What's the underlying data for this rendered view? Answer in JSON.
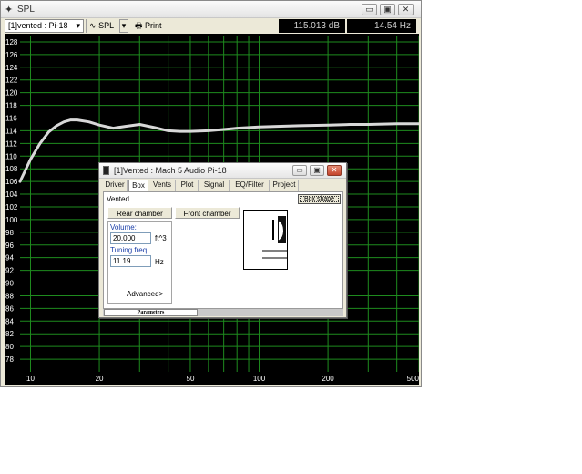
{
  "window": {
    "title": "SPL",
    "title_icon": "✦",
    "min_btn": "▭",
    "max_btn": "▣",
    "close_btn": "✕"
  },
  "toolbar": {
    "project_combo": "[1]vented : Pi-18",
    "combo_arrow": "▾",
    "spl_label": "SPL",
    "spl_icon": "∿",
    "spl_arrow": "▾",
    "print_label": "Print",
    "print_icon": "🖶",
    "db_readout": "115.013 dB",
    "hz_readout": "14.54 Hz"
  },
  "plot": {
    "y_ticks": [
      "128",
      "126",
      "124",
      "122",
      "120",
      "118",
      "116",
      "114",
      "112",
      "110",
      "108",
      "106",
      "104",
      "102",
      "100",
      "98",
      "96",
      "94",
      "92",
      "90",
      "88",
      "86",
      "84",
      "82",
      "80",
      "78"
    ],
    "x_ticks": [
      "10",
      "20",
      "50",
      "100",
      "200",
      "500"
    ],
    "colors": {
      "background": "#000000",
      "grid": "#1e8b1e",
      "curve": "#d8d8d8"
    }
  },
  "chart_data": {
    "type": "line",
    "title": "",
    "xlabel": "",
    "ylabel": "",
    "x_scale": "log",
    "xlim": [
      9,
      500
    ],
    "ylim": [
      76,
      129
    ],
    "grid": true,
    "series": [
      {
        "x": [
          9,
          10,
          11,
          12,
          13,
          14,
          15,
          16,
          18,
          20,
          23,
          26,
          30,
          35,
          40,
          45,
          50,
          60,
          70,
          80,
          100,
          120,
          150,
          200,
          250,
          300,
          400,
          500
        ],
        "y": [
          106.0,
          109.5,
          112.0,
          113.8,
          114.8,
          115.4,
          115.7,
          115.7,
          115.4,
          114.9,
          114.4,
          114.7,
          115.0,
          114.5,
          114.0,
          113.9,
          113.9,
          114.0,
          114.2,
          114.4,
          114.6,
          114.7,
          114.8,
          114.9,
          115.0,
          115.0,
          115.1,
          115.1
        ]
      }
    ]
  },
  "dialog": {
    "title": "[1]Vented : Mach 5 Audio Pi-18",
    "tabs": [
      "Driver",
      "Box",
      "Vents",
      "Plot",
      "Signal",
      "EQ/Filter",
      "Project"
    ],
    "box_type": "Vented",
    "box_shape_btn": "Box shape",
    "rear_chamber": "Rear chamber",
    "front_chamber": "Front chamber",
    "volume_label": "Volume:",
    "volume_value": "20.000",
    "volume_unit": "ft^3",
    "tuning_label": "Tuning freq.",
    "tuning_value": "11.19",
    "tuning_unit": "Hz",
    "advanced": "Advanced>",
    "status_tab": "Parameters"
  }
}
